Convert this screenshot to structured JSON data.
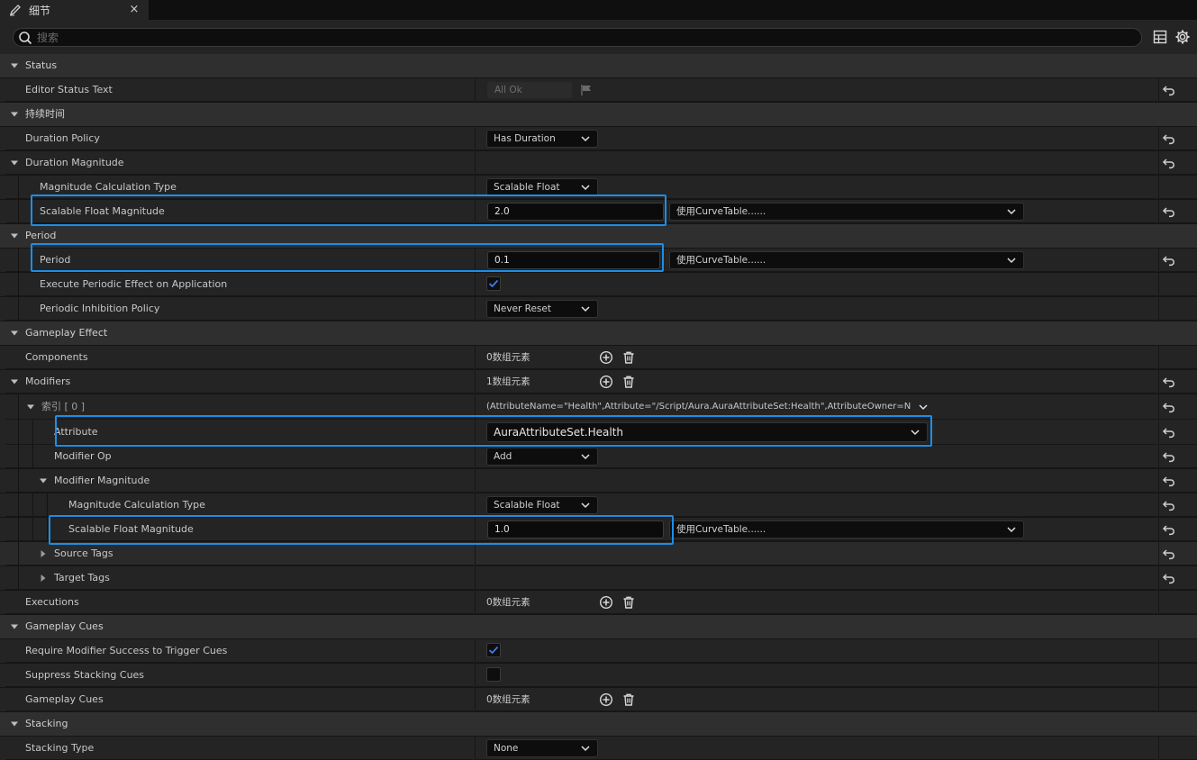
{
  "tab": {
    "title": "细节",
    "close": "×"
  },
  "search": {
    "placeholder": "搜索",
    "value": ""
  },
  "status": {
    "category": "Status",
    "editor_status_text": {
      "label": "Editor Status Text",
      "value": "All Ok"
    }
  },
  "duration": {
    "category": "持续时间",
    "policy": {
      "label": "Duration Policy",
      "value": "Has Duration"
    },
    "magnitude": {
      "label": "Duration Magnitude",
      "calc_type": {
        "label": "Magnitude Calculation Type",
        "value": "Scalable Float"
      },
      "scalable_float": {
        "label": "Scalable Float Magnitude",
        "value": "2.0",
        "curve": "使用CurveTable......"
      }
    }
  },
  "period": {
    "category": "Period",
    "period": {
      "label": "Period",
      "value": "0.1",
      "curve": "使用CurveTable......"
    },
    "execute_on_app": {
      "label": "Execute Periodic Effect on Application",
      "checked": true
    },
    "inhibition": {
      "label": "Periodic Inhibition Policy",
      "value": "Never Reset"
    }
  },
  "gameplay_effect": {
    "category": "Gameplay Effect",
    "components": {
      "label": "Components",
      "value": "0数组元素"
    },
    "modifiers": {
      "label": "Modifiers",
      "value": "1数组元素",
      "index0": {
        "label": "索引 [ 0 ]",
        "summary": "(AttributeName=\"Health\",Attribute=\"/Script/Aura.AuraAttributeSet:Health\",AttributeOwner=N",
        "attribute": {
          "label": "Attribute",
          "value": "AuraAttributeSet.Health"
        },
        "modifier_op": {
          "label": "Modifier Op",
          "value": "Add"
        },
        "modifier_magnitude": {
          "label": "Modifier Magnitude",
          "calc_type": {
            "label": "Magnitude Calculation Type",
            "value": "Scalable Float"
          },
          "scalable_float": {
            "label": "Scalable Float Magnitude",
            "value": "1.0",
            "curve": "使用CurveTable......"
          }
        },
        "source_tags": {
          "label": "Source Tags"
        },
        "target_tags": {
          "label": "Target Tags"
        }
      }
    },
    "executions": {
      "label": "Executions",
      "value": "0数组元素"
    }
  },
  "gameplay_cues": {
    "category": "Gameplay Cues",
    "require_success": {
      "label": "Require Modifier Success to Trigger Cues",
      "checked": true
    },
    "suppress_stacking": {
      "label": "Suppress Stacking Cues",
      "checked": false
    },
    "cues": {
      "label": "Gameplay Cues",
      "value": "0数组元素"
    }
  },
  "stacking": {
    "category": "Stacking",
    "type": {
      "label": "Stacking Type",
      "value": "None"
    }
  },
  "colors": {
    "highlight": "#1b8ee8",
    "check_accent": "#3d7bf0",
    "panel": "#242424",
    "category": "#2f2f2f"
  }
}
